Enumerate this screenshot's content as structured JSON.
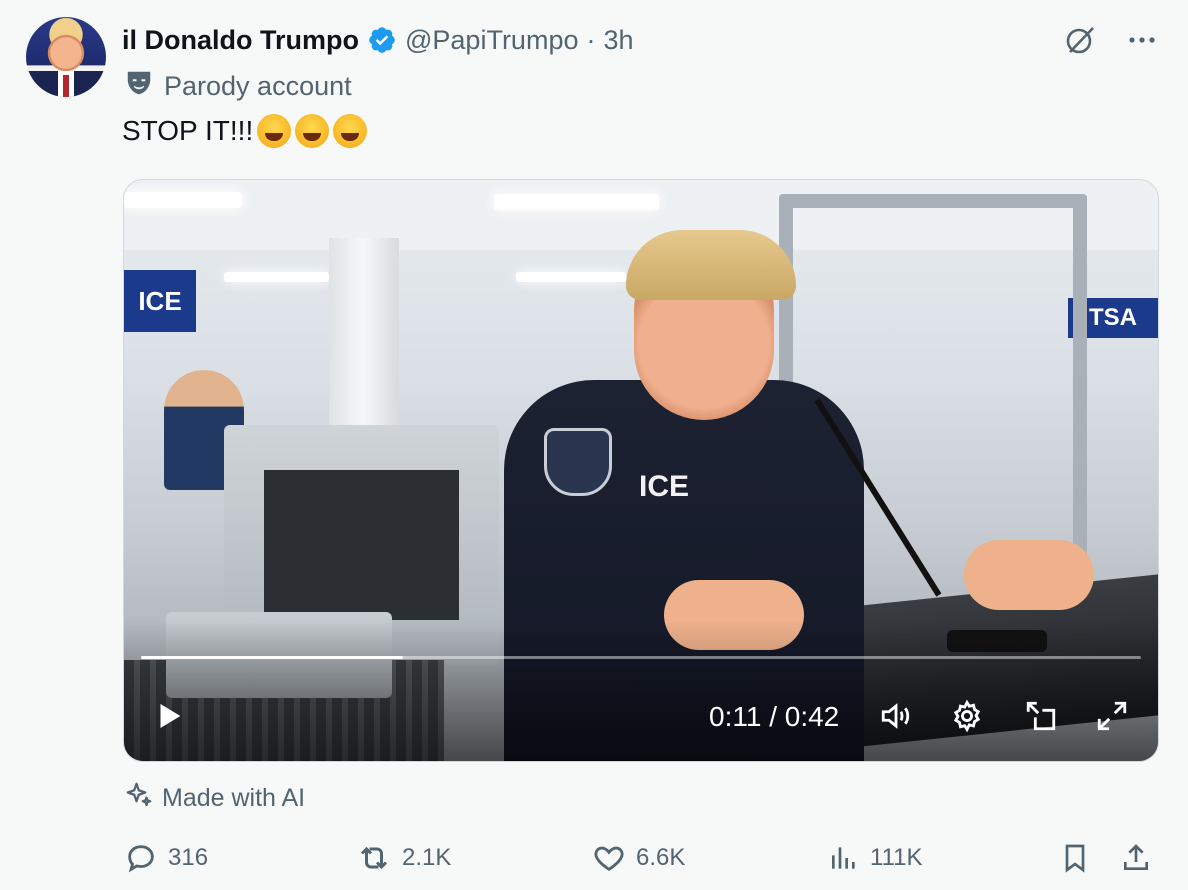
{
  "author": {
    "display_name": "il Donaldo Trumpo",
    "handle": "@PapiTrumpo",
    "separator": "·",
    "time": "3h",
    "label": "Parody account"
  },
  "tweet": {
    "text": "STOP IT!!!",
    "emoji_count": 3
  },
  "media": {
    "scene_signs": {
      "left": "ICE",
      "right": "TSA",
      "uniform": "ICE"
    },
    "video_time": "0:11 / 0:42",
    "progress_fraction": 0.262
  },
  "ai_label": "Made with AI",
  "actions": {
    "replies": "316",
    "reposts": "2.1K",
    "likes": "6.6K",
    "views": "111K"
  },
  "colors": {
    "verified": "#1d9bf0",
    "muted": "#536471",
    "text": "#0f1419"
  }
}
